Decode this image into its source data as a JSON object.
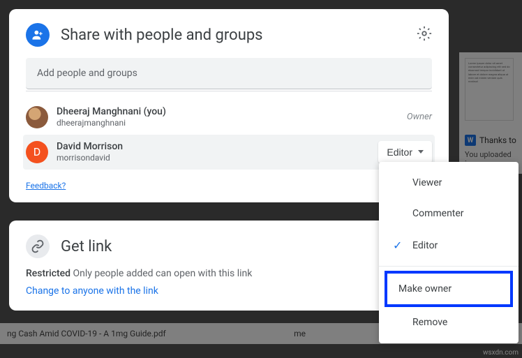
{
  "share": {
    "title": "Share with people and groups",
    "input_placeholder": "Add people and groups",
    "people": [
      {
        "name": "Dheeraj Manghnani (you)",
        "email": "dheerajmanghnani",
        "role": "Owner",
        "avatar_letter": "",
        "avatar_type": "img"
      },
      {
        "name": "David Morrison",
        "email": "morrisondavid",
        "role": "Editor",
        "avatar_letter": "D",
        "avatar_type": "orange"
      }
    ],
    "feedback": "Feedback?"
  },
  "link": {
    "title": "Get link",
    "restricted_label": "Restricted",
    "restricted_desc": " Only people added can open with this link",
    "change": "Change to anyone with the link"
  },
  "dropdown": {
    "items": [
      "Viewer",
      "Commenter",
      "Editor"
    ],
    "selected": "Editor",
    "make_owner": "Make owner",
    "remove": "Remove"
  },
  "background": {
    "notice_icon": "W",
    "notice_text": "Thanks to",
    "upload_text": "You uploaded in",
    "bottom_file": "ng Cash Amid COVID-19 - A 1mg Guide.pdf",
    "bottom_owner": "me"
  },
  "watermark": "wsxdn.com"
}
